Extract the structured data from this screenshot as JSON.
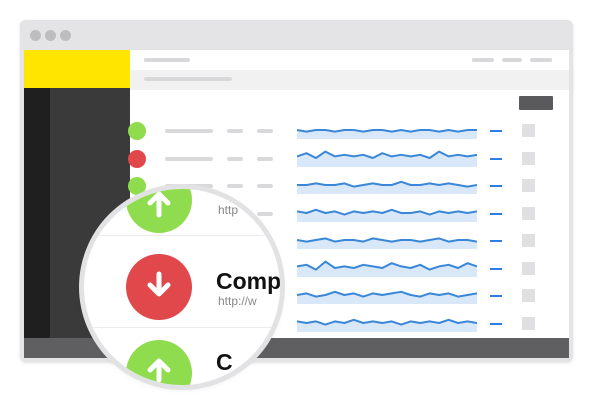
{
  "colors": {
    "up": "#8fdc4e",
    "down": "#e0484c",
    "spark_line": "#3a87d8",
    "spark_fill": "#d8e8f8",
    "logo": "#ffe500"
  },
  "window": {
    "controls": [
      "close-dot",
      "minimize-dot",
      "maximize-dot"
    ]
  },
  "rows": [
    {
      "status": "up",
      "spark": [
        5,
        4,
        5,
        5,
        4,
        5,
        5,
        4,
        5,
        5,
        4,
        5,
        4,
        5,
        5,
        4,
        5,
        4,
        5,
        5
      ]
    },
    {
      "status": "down",
      "spark": [
        6,
        8,
        5,
        9,
        6,
        7,
        6,
        7,
        5,
        8,
        6,
        7,
        6,
        7,
        5,
        9,
        6,
        7,
        6,
        7
      ]
    },
    {
      "status": "up",
      "spark": [
        5,
        5,
        6,
        5,
        5,
        6,
        4,
        5,
        6,
        5,
        5,
        7,
        5,
        5,
        6,
        5,
        6,
        5,
        4,
        5
      ]
    },
    {
      "status": "up",
      "spark": [
        6,
        5,
        7,
        5,
        6,
        4,
        6,
        5,
        6,
        5,
        7,
        5,
        5,
        6,
        4,
        6,
        5,
        6,
        5,
        6
      ]
    },
    {
      "status": "up",
      "spark": [
        5,
        4,
        5,
        6,
        4,
        5,
        5,
        4,
        6,
        5,
        4,
        5,
        5,
        4,
        5,
        6,
        4,
        5,
        5,
        4
      ]
    },
    {
      "status": "down",
      "spark": [
        6,
        7,
        4,
        9,
        5,
        6,
        5,
        7,
        6,
        5,
        8,
        6,
        5,
        7,
        4,
        6,
        7,
        5,
        8,
        6
      ]
    },
    {
      "status": "up",
      "spark": [
        5,
        6,
        4,
        5,
        7,
        5,
        6,
        4,
        6,
        5,
        6,
        7,
        5,
        4,
        6,
        5,
        6,
        4,
        5,
        6
      ]
    },
    {
      "status": "up",
      "spark": [
        6,
        5,
        6,
        4,
        6,
        5,
        7,
        5,
        6,
        5,
        6,
        4,
        6,
        5,
        6,
        5,
        7,
        5,
        6,
        5
      ]
    }
  ],
  "magnifier": {
    "top_url": "http",
    "row_title": "Comp",
    "row_url": "http://w",
    "bottom_title": "C"
  }
}
